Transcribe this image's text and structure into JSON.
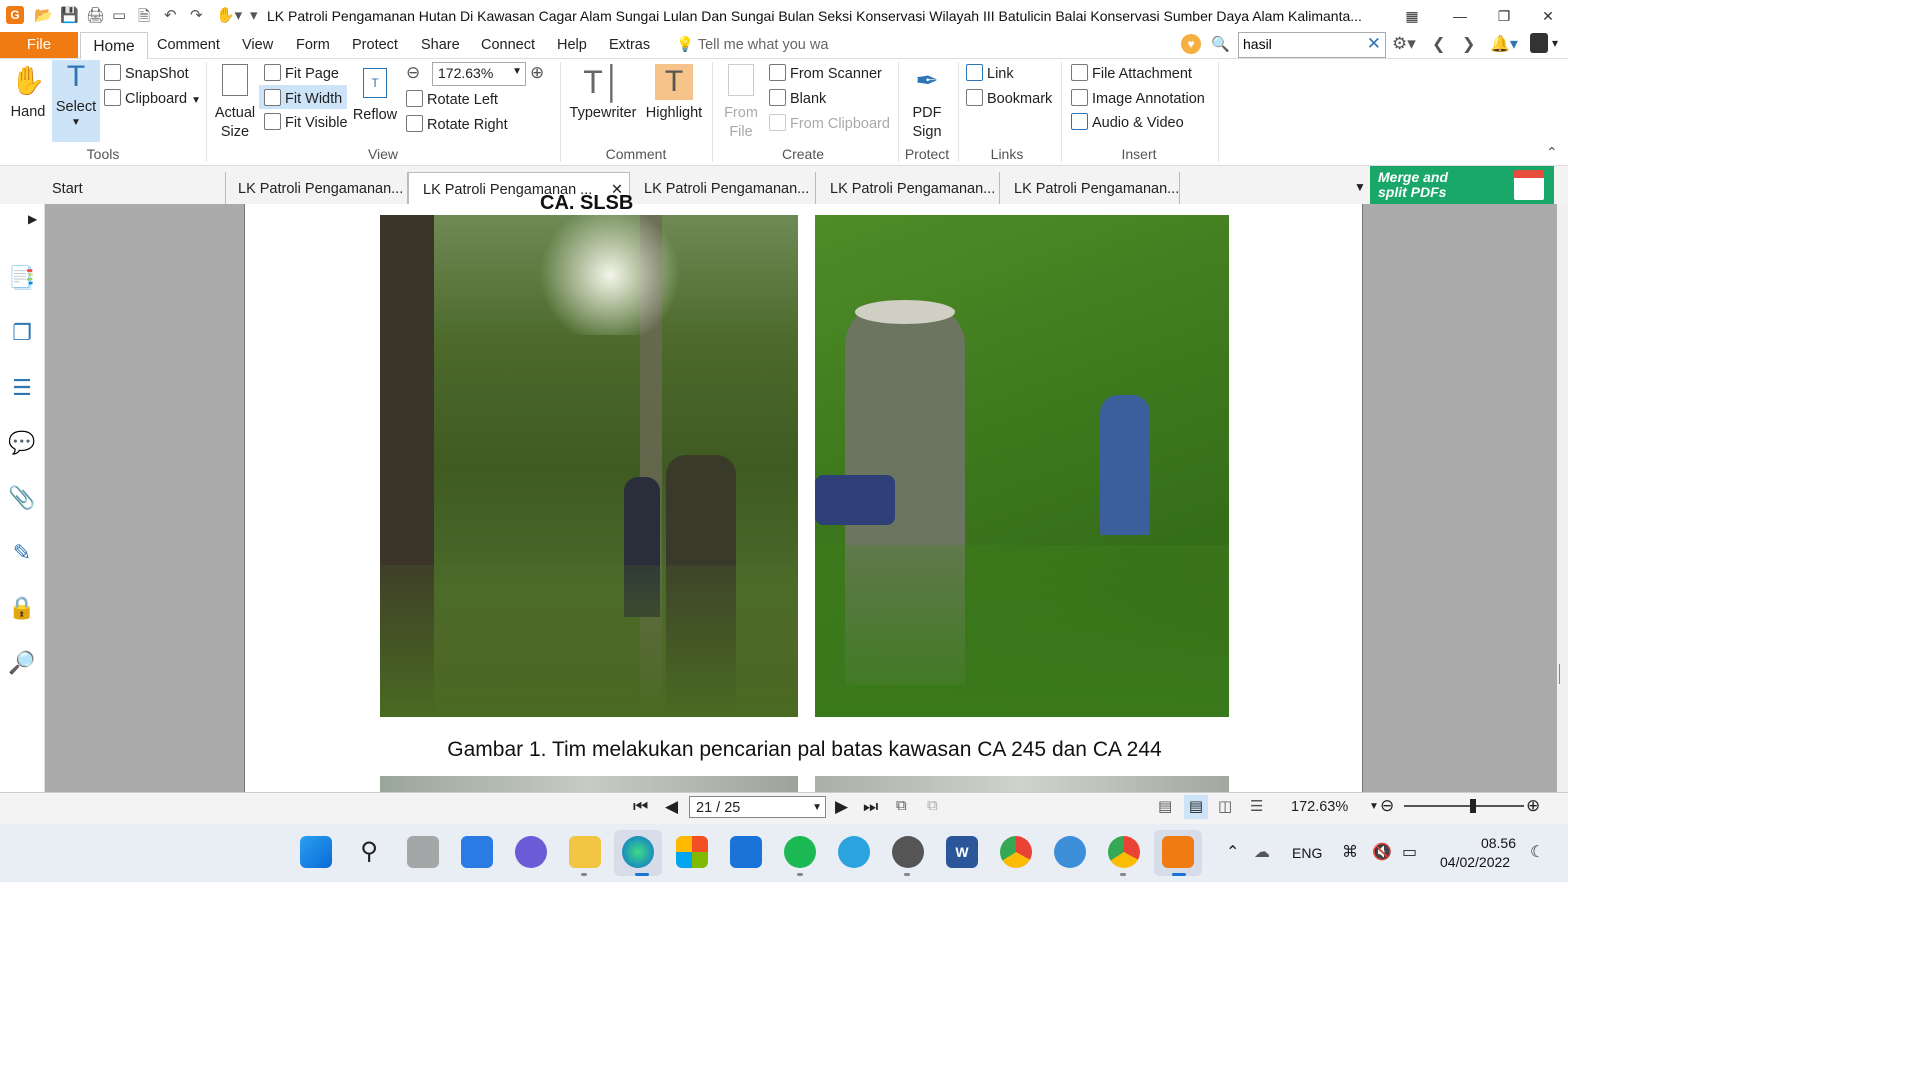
{
  "app": {
    "title": "LK Patroli Pengamanan Hutan Di Kawasan Cagar Alam Sungai Lulan Dan Sungai Bulan Seksi Konservasi Wilayah III Batulicin Balai Konservasi Sumber Daya Alam Kalimanta...",
    "brand_color": "#f07b12"
  },
  "menu": {
    "file": "File",
    "home": "Home",
    "items": [
      "Comment",
      "View",
      "Form",
      "Protect",
      "Share",
      "Connect",
      "Help",
      "Extras"
    ],
    "tell_me": "Tell me what you wa",
    "search_value": "hasil"
  },
  "ribbon": {
    "tools": {
      "hand": "Hand",
      "select": "Select",
      "snapshot": "SnapShot",
      "clipboard": "Clipboard",
      "group": "Tools"
    },
    "view": {
      "actual_size_1": "Actual",
      "actual_size_2": "Size",
      "fit_page": "Fit Page",
      "fit_width": "Fit Width",
      "fit_visible": "Fit Visible",
      "reflow": "Reflow",
      "zoom": "172.63%",
      "rotate_left": "Rotate Left",
      "rotate_right": "Rotate Right",
      "group": "View"
    },
    "comment": {
      "typewriter": "Typewriter",
      "highlight": "Highlight",
      "group": "Comment"
    },
    "create": {
      "from_file_1": "From",
      "from_file_2": "File",
      "from_scanner": "From Scanner",
      "blank": "Blank",
      "from_clipboard": "From Clipboard",
      "group": "Create"
    },
    "protect": {
      "pdf_sign_1": "PDF",
      "pdf_sign_2": "Sign",
      "group": "Protect"
    },
    "links": {
      "link": "Link",
      "bookmark": "Bookmark",
      "group": "Links"
    },
    "insert": {
      "file_attachment": "File Attachment",
      "image_annotation": "Image Annotation",
      "audio_video": "Audio & Video",
      "group": "Insert"
    }
  },
  "tabs": [
    {
      "label": "Start"
    },
    {
      "label": "LK Patroli Pengamanan..."
    },
    {
      "label": "LK Patroli Pengamanan ..."
    },
    {
      "label": "LK Patroli Pengamanan..."
    },
    {
      "label": "LK Patroli Pengamanan..."
    },
    {
      "label": "LK Patroli Pengamanan..."
    }
  ],
  "banner": {
    "line1": "Merge and",
    "line2": "split PDFs",
    "color": "#1aa86a"
  },
  "document": {
    "heading_fragment": "CA. SLSB",
    "caption": "Gambar 1. Tim melakukan pencarian pal batas kawasan CA 245 dan CA 244"
  },
  "status": {
    "page": "21 / 25",
    "zoom": "172.63%"
  },
  "taskbar": {
    "language": "ENG",
    "time": "08.56",
    "date": "04/02/2022"
  }
}
